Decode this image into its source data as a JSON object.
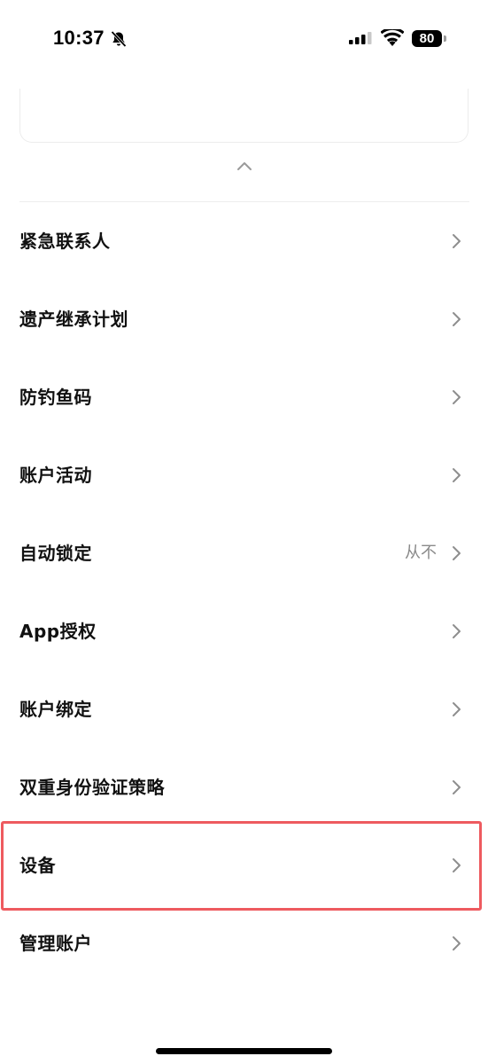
{
  "status_bar": {
    "time": "10:37",
    "battery": "80",
    "icons": [
      "bell-slash-icon",
      "signal-icon",
      "wifi-icon",
      "battery-icon"
    ]
  },
  "header": {
    "back_icon": "arrow-left-icon",
    "collapse_icon": "chevron-up-icon"
  },
  "menu": {
    "items": [
      {
        "label": "紧急联系人",
        "value": ""
      },
      {
        "label": "遗产继承计划",
        "value": ""
      },
      {
        "label": "防钓鱼码",
        "value": ""
      },
      {
        "label": "账户活动",
        "value": ""
      },
      {
        "label": "自动锁定",
        "value": "从不"
      },
      {
        "label": "App授权",
        "value": ""
      },
      {
        "label": "账户绑定",
        "value": ""
      },
      {
        "label": "双重身份验证策略",
        "value": ""
      },
      {
        "label": "设备",
        "value": ""
      },
      {
        "label": "管理账户",
        "value": ""
      }
    ],
    "highlighted_item": "设备"
  },
  "colors": {
    "highlight": "#ee5a5f",
    "chevron": "#8e8e8e",
    "value_text": "#8a8a8a"
  }
}
